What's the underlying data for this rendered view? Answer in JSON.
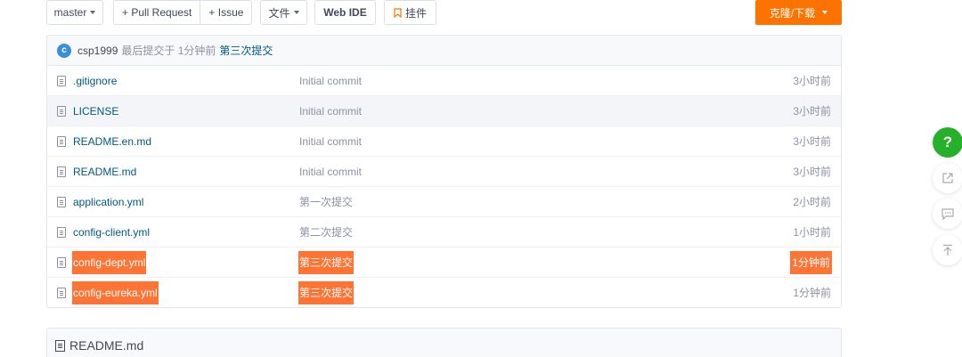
{
  "toolbar": {
    "branch": "master",
    "pull_request": "+ Pull Request",
    "issue": "+ Issue",
    "files": "文件",
    "web_ide": "Web IDE",
    "bookmark": "挂件",
    "clone": "克隆/下载"
  },
  "last_commit": {
    "avatar_letter": "c",
    "user": "csp1999",
    "meta": "最后提交于 1分钟前",
    "message": "第三次提交"
  },
  "files": [
    {
      "name": ".gitignore",
      "message": "Initial commit",
      "time": "3小时前"
    },
    {
      "name": "LICENSE",
      "message": "Initial commit",
      "time": "3小时前"
    },
    {
      "name": "README.en.md",
      "message": "Initial commit",
      "time": "3小时前"
    },
    {
      "name": "README.md",
      "message": "Initial commit",
      "time": "3小时前"
    },
    {
      "name": "application.yml",
      "message": "第一次提交",
      "time": "2小时前"
    },
    {
      "name": "config-client.yml",
      "message": "第二次提交",
      "time": "1小时前"
    },
    {
      "name": "config-dept.yml",
      "message": "第三次提交",
      "time": "1分钟前"
    },
    {
      "name": "config-eureka.yml",
      "message": "第三次提交",
      "time": "1分钟前"
    }
  ],
  "readme": {
    "title": "README.md"
  },
  "side": {
    "help": "?"
  },
  "colors": {
    "accent": "#fe7300",
    "highlight": "#fe7435",
    "link": "#005980",
    "help": "#27b12a"
  }
}
